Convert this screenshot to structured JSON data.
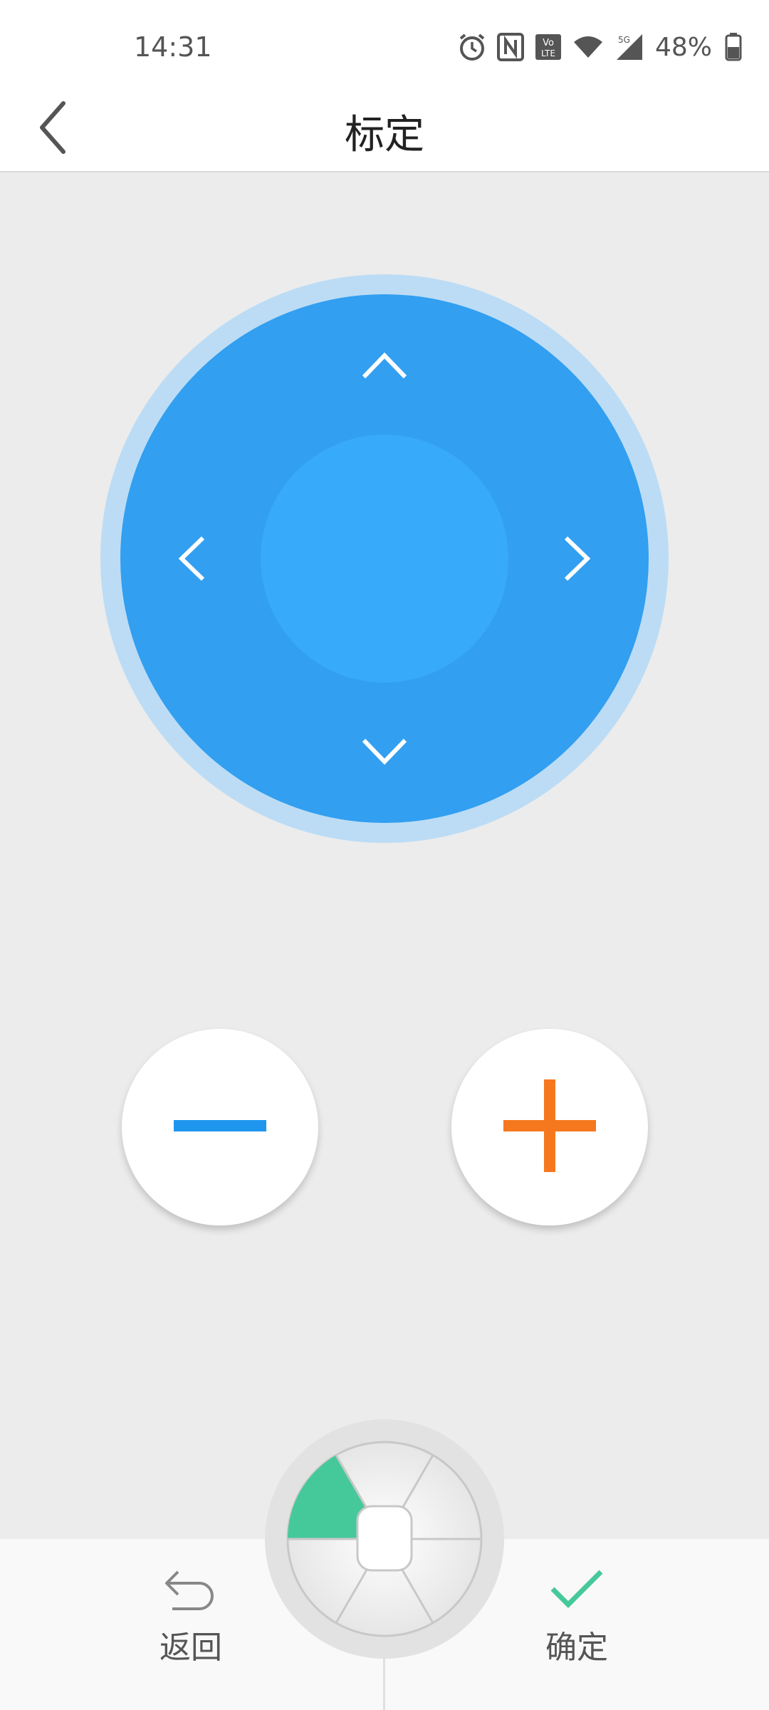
{
  "status_bar": {
    "time": "14:31",
    "battery": "48%",
    "icons": [
      "alarm-icon",
      "nfc-icon",
      "volte-icon",
      "wifi-icon",
      "5g-signal-icon",
      "battery-icon"
    ]
  },
  "header": {
    "title": "标定",
    "back_icon": "chevron-left-icon"
  },
  "dpad": {
    "arrows": [
      "up",
      "down",
      "left",
      "right"
    ],
    "colors": {
      "outer": "#bcdcf5",
      "inner": "#329ff0",
      "center": "#38aafa"
    }
  },
  "controls": {
    "decrease_icon": "minus-icon",
    "increase_icon": "plus-icon",
    "colors": {
      "minus": "#1e96ee",
      "plus": "#f5781f"
    }
  },
  "bottom_bar": {
    "back_label": "返回",
    "confirm_label": "确定",
    "colors": {
      "confirm_check": "#46c99a",
      "wheel_segment": "#46c99a"
    }
  }
}
